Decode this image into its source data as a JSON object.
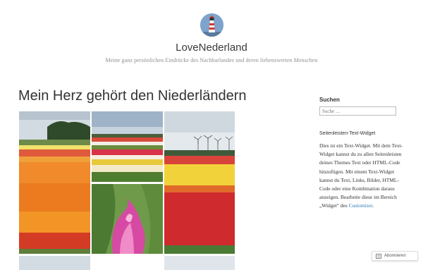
{
  "site": {
    "logo_icon": "lighthouse-icon",
    "title": "LoveNederland",
    "description": "Meine ganz persönlichen Eindrücke des Nachbarlandes und deren liebenswerten Menschen"
  },
  "post": {
    "title": "Mein Herz gehört den Niederländern",
    "gallery": [
      {
        "name": "tulip-field-orange-photo"
      },
      {
        "name": "tulip-rows-photo"
      },
      {
        "name": "tulip-field-windmills-photo"
      },
      {
        "name": "pink-tulip-closeup-photo"
      }
    ]
  },
  "sidebar": {
    "search": {
      "title": "Suchen",
      "placeholder": "Suche …"
    },
    "text_widget": {
      "title": "Seitenleisten-Text-Widget",
      "body": "Dies ist ein Text-Widget. Mit dem Text-Widget kannst du zu allen Seitenleisten deines Themes Text oder HTML-Code hinzufügen. Bilder, HTML-Code oder eine Kombination daraus anzeigen. Bearbeite diese im Bereich „Widget“ des ",
      "body_line1": "Dies ist ein Text-Widget. Mit dem Text-Widget kannst du zu allen Seitenleisten deines Themes Text oder HTML-Code hinzufügen. Mit einem Text-Widget kannst du Text, Links, Bilder, HTML-Code oder eine Kombination daraus anzeigen. Bearbeite diese im Bereich „Widget“ des ",
      "link": "Customizer",
      "trailing": "."
    }
  },
  "follow_button": {
    "label": "Abonnieren",
    "icon": "reader-icon"
  },
  "colors": {
    "link": "#2b7bb9",
    "logo_bg": "#7a9fc9"
  }
}
